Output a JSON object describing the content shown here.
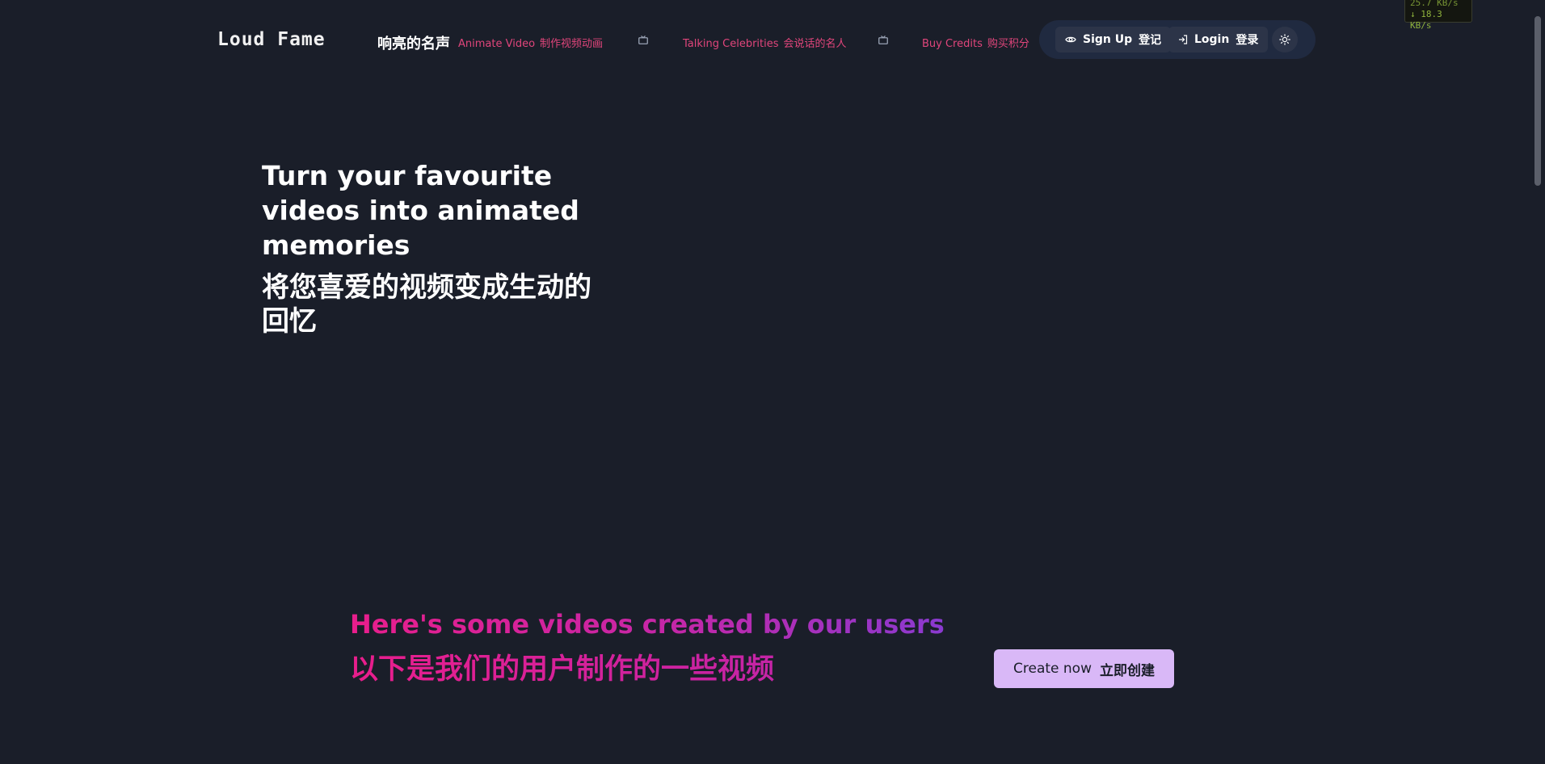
{
  "netspeed": {
    "up": "25.7 KB/s",
    "down": "↓ 18.3 KB/s"
  },
  "header": {
    "logo": "Loud Fame",
    "logo_cn": "响亮的名声",
    "nav": [
      {
        "en": "Animate Video",
        "cn": "制作视频动画"
      },
      {
        "en": "Talking Celebrities",
        "cn": "会说话的名人"
      },
      {
        "en": "Buy Credits",
        "cn": "购买积分"
      }
    ],
    "signup": {
      "en": "Sign Up",
      "cn": "登记"
    },
    "login": {
      "en": "Login",
      "cn": "登录"
    },
    "theme_icon": "sun-icon"
  },
  "hero": {
    "title_en": "Turn your favourite videos into animated memories",
    "title_cn": "将您喜爱的视频变成生动的回忆"
  },
  "users_section": {
    "title_en": "Here's some videos created by our users",
    "title_cn": "以下是我们的用户制作的一些视频",
    "create_button": {
      "en": "Create now",
      "cn": "立即创建"
    }
  },
  "colors": {
    "background": "#1a1e29",
    "nav_link": "#e0457b",
    "gradient_start": "#e91e8c",
    "gradient_end": "#8a3ad0",
    "create_button_bg": "#d9b8f7"
  }
}
